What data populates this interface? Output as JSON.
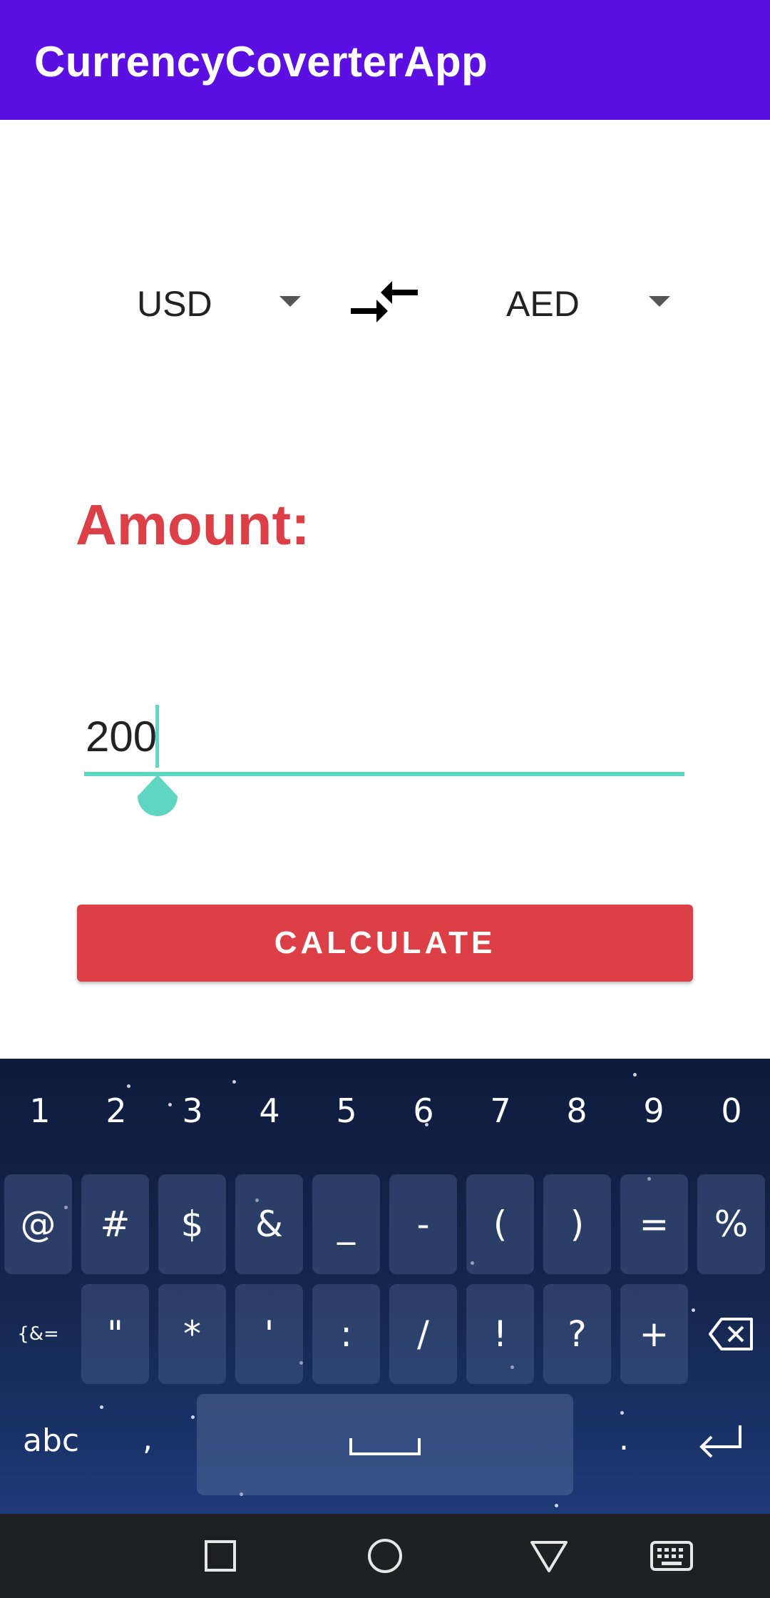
{
  "app": {
    "title": "CurrencyCoverterApp",
    "accent": "#5c0fe3"
  },
  "converter": {
    "from_currency": "USD",
    "to_currency": "AED",
    "swap_icon": "swap-arrows-icon",
    "amount_label": "Amount:",
    "amount_value": "200",
    "calculate_label": "CALCULATE",
    "label_color": "#dc3f45",
    "input_accent": "#5fd6c2"
  },
  "keyboard": {
    "numbers": [
      "1",
      "2",
      "3",
      "4",
      "5",
      "6",
      "7",
      "8",
      "9",
      "0"
    ],
    "symbols_row1": [
      "@",
      "#",
      "$",
      "&",
      "_",
      "-",
      "(",
      ")",
      "=",
      "%"
    ],
    "symbols_row2_toggle": "{&=",
    "symbols_row2": [
      "\"",
      "*",
      "'",
      ":",
      "/",
      "!",
      "?",
      "+"
    ],
    "abc_label": "abc",
    "comma": ",",
    "period": ".",
    "backspace_icon": "backspace-icon",
    "enter_icon": "enter-icon",
    "space_icon": "space-bar-icon"
  },
  "navbar": {
    "icons": [
      "recents-square-icon",
      "home-circle-icon",
      "back-triangle-icon",
      "keyboard-icon"
    ]
  }
}
